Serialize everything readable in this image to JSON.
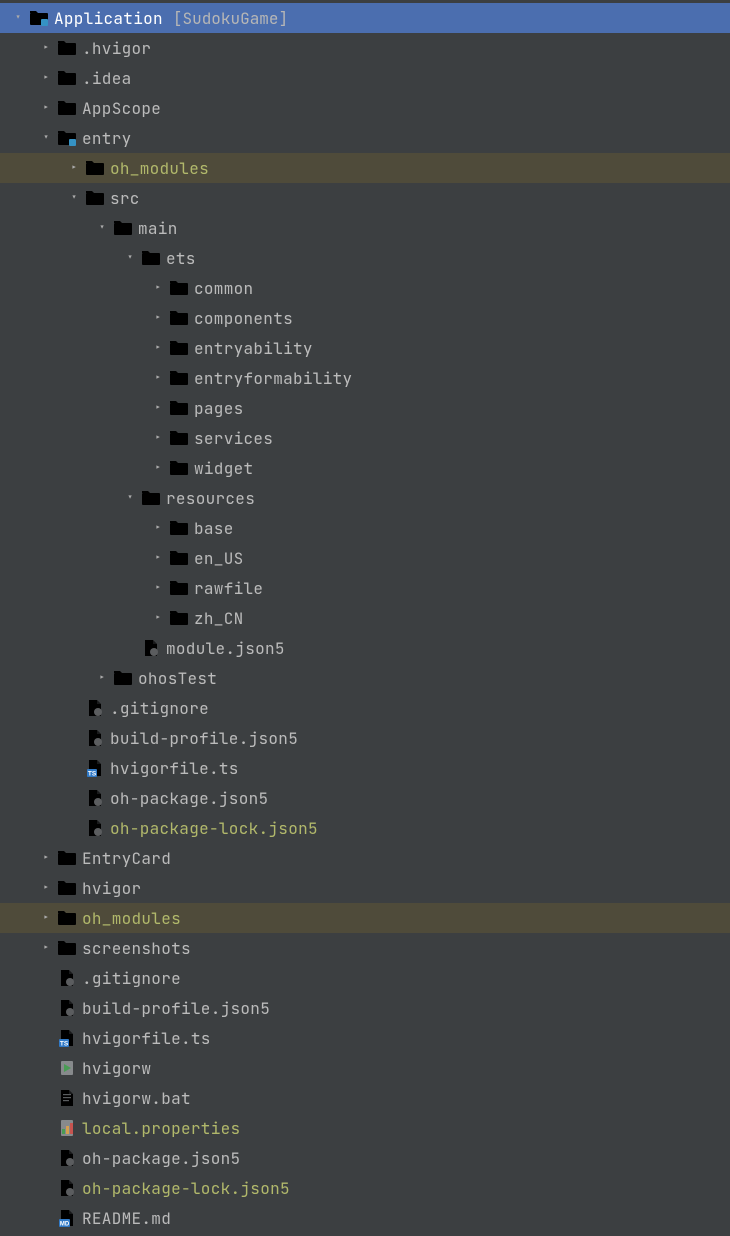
{
  "tree": [
    {
      "depth": 0,
      "chevron": "down",
      "icon": "folder-module",
      "label": "Application",
      "color": "white",
      "selected": true,
      "bracket": "[SudokuGame]"
    },
    {
      "depth": 1,
      "chevron": "right",
      "icon": "folder-gray",
      "label": ".hvigor",
      "color": "gray"
    },
    {
      "depth": 1,
      "chevron": "right",
      "icon": "folder-gray",
      "label": ".idea",
      "color": "gray"
    },
    {
      "depth": 1,
      "chevron": "right",
      "icon": "folder-gray",
      "label": "AppScope",
      "color": "gray"
    },
    {
      "depth": 1,
      "chevron": "down",
      "icon": "folder-module",
      "label": "entry",
      "color": "gray"
    },
    {
      "depth": 2,
      "chevron": "right",
      "icon": "folder-orange",
      "label": "oh_modules",
      "color": "olive",
      "highlighted": true
    },
    {
      "depth": 2,
      "chevron": "down",
      "icon": "folder-gray",
      "label": "src",
      "color": "gray"
    },
    {
      "depth": 3,
      "chevron": "down",
      "icon": "folder-gray",
      "label": "main",
      "color": "gray"
    },
    {
      "depth": 4,
      "chevron": "down",
      "icon": "folder-gray",
      "label": "ets",
      "color": "gray"
    },
    {
      "depth": 5,
      "chevron": "right",
      "icon": "folder-gray",
      "label": "common",
      "color": "gray"
    },
    {
      "depth": 5,
      "chevron": "right",
      "icon": "folder-gray",
      "label": "components",
      "color": "gray"
    },
    {
      "depth": 5,
      "chevron": "right",
      "icon": "folder-gray",
      "label": "entryability",
      "color": "gray"
    },
    {
      "depth": 5,
      "chevron": "right",
      "icon": "folder-gray",
      "label": "entryformability",
      "color": "gray"
    },
    {
      "depth": 5,
      "chevron": "right",
      "icon": "folder-gray",
      "label": "pages",
      "color": "gray"
    },
    {
      "depth": 5,
      "chevron": "right",
      "icon": "folder-gray",
      "label": "services",
      "color": "gray"
    },
    {
      "depth": 5,
      "chevron": "right",
      "icon": "folder-gray",
      "label": "widget",
      "color": "gray"
    },
    {
      "depth": 4,
      "chevron": "down",
      "icon": "folder-gray",
      "label": "resources",
      "color": "gray"
    },
    {
      "depth": 5,
      "chevron": "right",
      "icon": "folder-gray",
      "label": "base",
      "color": "gray"
    },
    {
      "depth": 5,
      "chevron": "right",
      "icon": "folder-gray",
      "label": "en_US",
      "color": "gray"
    },
    {
      "depth": 5,
      "chevron": "right",
      "icon": "folder-gray",
      "label": "rawfile",
      "color": "gray"
    },
    {
      "depth": 5,
      "chevron": "right",
      "icon": "folder-gray",
      "label": "zh_CN",
      "color": "gray"
    },
    {
      "depth": 4,
      "chevron": "none",
      "icon": "file-json",
      "label": "module.json5",
      "color": "gray"
    },
    {
      "depth": 3,
      "chevron": "right",
      "icon": "folder-gray",
      "label": "ohosTest",
      "color": "gray"
    },
    {
      "depth": 2,
      "chevron": "none",
      "icon": "file-json",
      "label": ".gitignore",
      "color": "gray"
    },
    {
      "depth": 2,
      "chevron": "none",
      "icon": "file-json",
      "label": "build-profile.json5",
      "color": "gray"
    },
    {
      "depth": 2,
      "chevron": "none",
      "icon": "file-ts",
      "label": "hvigorfile.ts",
      "color": "gray"
    },
    {
      "depth": 2,
      "chevron": "none",
      "icon": "file-json",
      "label": "oh-package.json5",
      "color": "gray"
    },
    {
      "depth": 2,
      "chevron": "none",
      "icon": "file-json",
      "label": "oh-package-lock.json5",
      "color": "olive"
    },
    {
      "depth": 1,
      "chevron": "right",
      "icon": "folder-gray",
      "label": "EntryCard",
      "color": "gray"
    },
    {
      "depth": 1,
      "chevron": "right",
      "icon": "folder-gray",
      "label": "hvigor",
      "color": "gray"
    },
    {
      "depth": 1,
      "chevron": "right",
      "icon": "folder-orange",
      "label": "oh_modules",
      "color": "olive",
      "highlighted": true
    },
    {
      "depth": 1,
      "chevron": "right",
      "icon": "folder-gray",
      "label": "screenshots",
      "color": "gray"
    },
    {
      "depth": 1,
      "chevron": "none",
      "icon": "file-json",
      "label": ".gitignore",
      "color": "gray"
    },
    {
      "depth": 1,
      "chevron": "none",
      "icon": "file-json",
      "label": "build-profile.json5",
      "color": "gray"
    },
    {
      "depth": 1,
      "chevron": "none",
      "icon": "file-ts",
      "label": "hvigorfile.ts",
      "color": "gray"
    },
    {
      "depth": 1,
      "chevron": "none",
      "icon": "file-exe",
      "label": "hvigorw",
      "color": "gray"
    },
    {
      "depth": 1,
      "chevron": "none",
      "icon": "file-txt",
      "label": "hvigorw.bat",
      "color": "gray"
    },
    {
      "depth": 1,
      "chevron": "none",
      "icon": "file-prop",
      "label": "local.properties",
      "color": "olive"
    },
    {
      "depth": 1,
      "chevron": "none",
      "icon": "file-json",
      "label": "oh-package.json5",
      "color": "gray"
    },
    {
      "depth": 1,
      "chevron": "none",
      "icon": "file-json",
      "label": "oh-package-lock.json5",
      "color": "olive"
    },
    {
      "depth": 1,
      "chevron": "none",
      "icon": "file-md",
      "label": "README.md",
      "color": "gray"
    }
  ],
  "indent_unit": 28,
  "base_indent": 8
}
